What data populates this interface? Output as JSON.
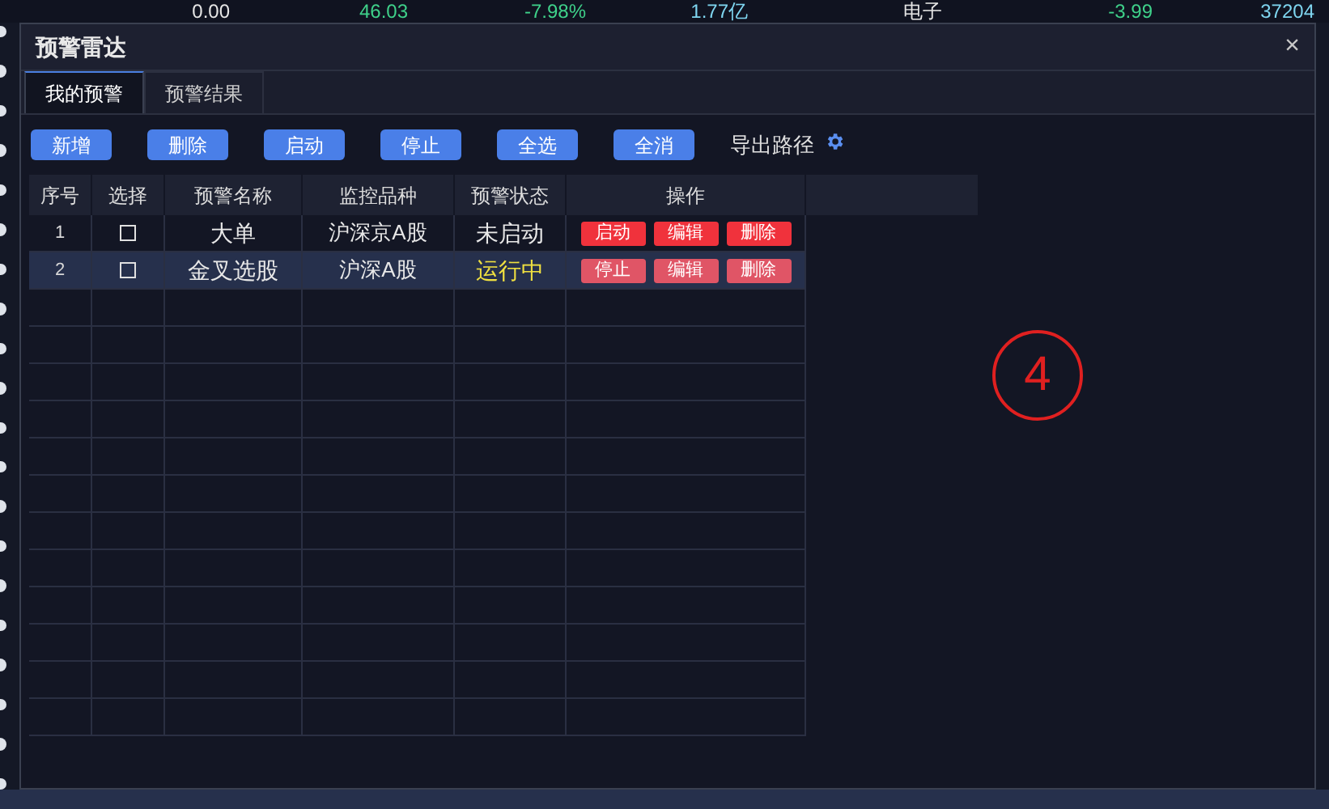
{
  "background_row": [
    {
      "text": "0.00",
      "color": "#e6e6e6"
    },
    {
      "text": "46.03",
      "color": "#3fd18a"
    },
    {
      "text": "-7.98%",
      "color": "#3fd18a"
    },
    {
      "text": "1.77亿",
      "color": "#7fd6f0"
    },
    {
      "text": "电子",
      "color": "#e6e6e6"
    },
    {
      "text": "-3.99",
      "color": "#3fd18a"
    },
    {
      "text": "37204",
      "color": "#7fd6f0"
    }
  ],
  "window": {
    "title": "预警雷达",
    "close": "×"
  },
  "tabs": [
    {
      "label": "我的预警",
      "selected": true
    },
    {
      "label": "预警结果",
      "selected": false
    }
  ],
  "toolbar": {
    "buttons": [
      "新增",
      "删除",
      "启动",
      "停止",
      "全选",
      "全消"
    ],
    "export_label": "导出路径"
  },
  "table": {
    "columns": [
      "序号",
      "选择",
      "预警名称",
      "监控品种",
      "预警状态",
      "操作"
    ],
    "rows": [
      {
        "index": "1",
        "checked": false,
        "name": "大单",
        "market": "沪深京A股",
        "status": "未启动",
        "running": false,
        "selected": false,
        "actions": [
          "启动",
          "编辑",
          "删除"
        ]
      },
      {
        "index": "2",
        "checked": false,
        "name": "金叉选股",
        "market": "沪深A股",
        "status": "运行中",
        "running": true,
        "selected": true,
        "actions": [
          "停止",
          "编辑",
          "删除"
        ]
      }
    ]
  },
  "annotation": {
    "text": "4"
  }
}
